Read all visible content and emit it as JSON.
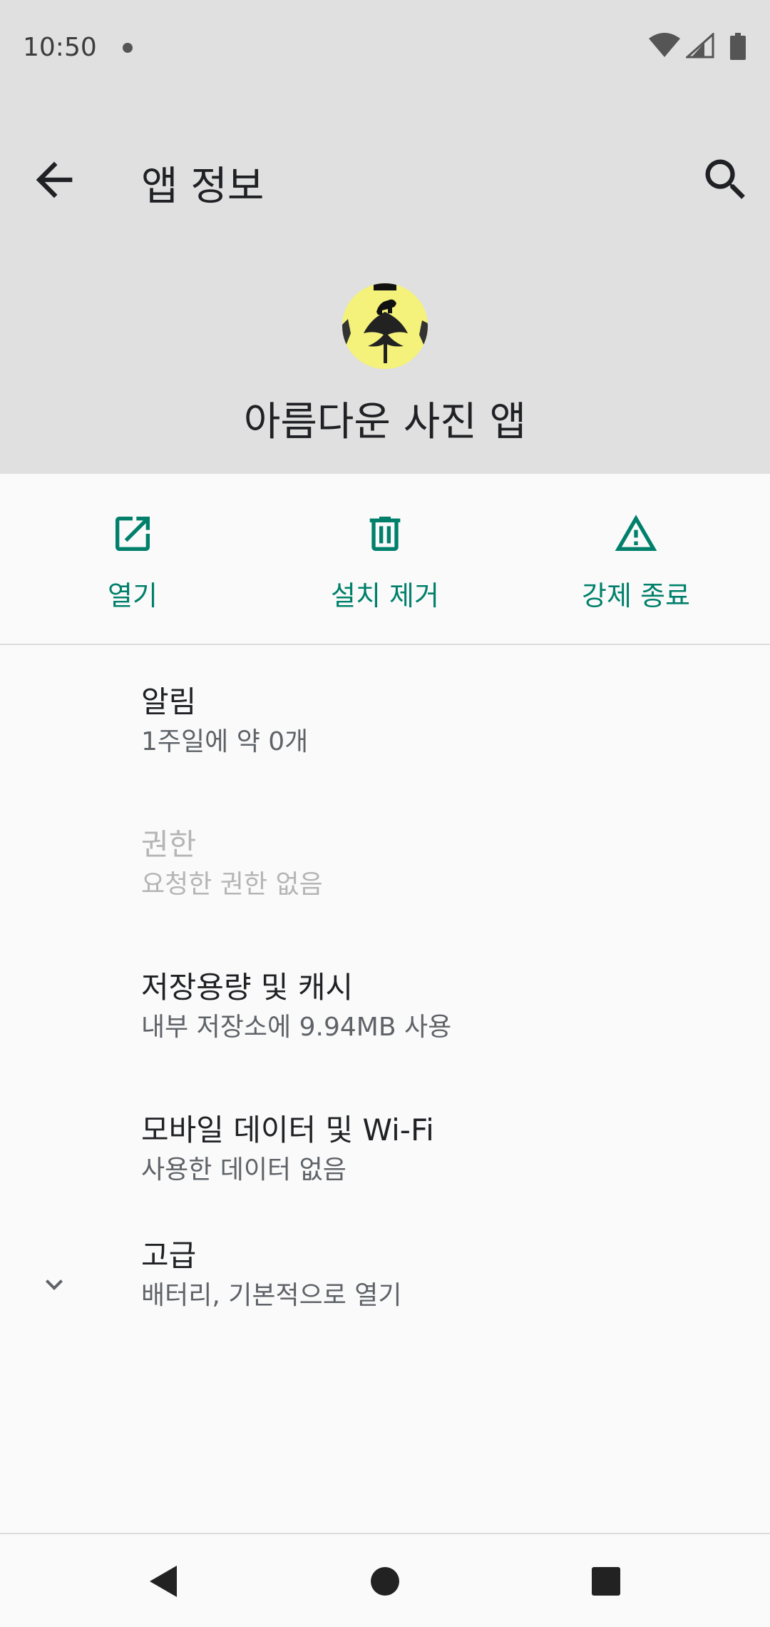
{
  "status_bar": {
    "time": "10:50",
    "icons": [
      "notification-dot",
      "wifi-icon",
      "cell-signal-icon",
      "battery-icon"
    ]
  },
  "app_bar": {
    "title": "앱 정보",
    "back_icon": "arrow-back-icon",
    "search_icon": "search-icon"
  },
  "app": {
    "name": "아름다운 사진 앱",
    "icon": "app-icon-monkey-tree"
  },
  "actions": [
    {
      "label": "열기",
      "icon": "open-external-icon"
    },
    {
      "label": "설치 제거",
      "icon": "trash-icon"
    },
    {
      "label": "강제 종료",
      "icon": "warning-icon"
    }
  ],
  "settings": [
    {
      "title": "알림",
      "summary": "1주일에 약 0개",
      "enabled": true
    },
    {
      "title": "권한",
      "summary": "요청한 권한 없음",
      "enabled": false
    },
    {
      "title": "저장용량 및 캐시",
      "summary": "내부 저장소에 9.94MB 사용",
      "enabled": true
    },
    {
      "title": "모바일 데이터 및 Wi-Fi",
      "summary": "사용한 데이터 없음",
      "enabled": true
    },
    {
      "title": "고급",
      "summary": "배터리, 기본적으로 열기",
      "enabled": true,
      "icon": "chevron-down-icon"
    }
  ],
  "nav_bar": {
    "buttons": [
      "back-triangle-icon",
      "home-circle-icon",
      "recents-square-icon"
    ]
  },
  "colors": {
    "accent": "#00806b",
    "header_bg": "#e0e0e0",
    "page_bg": "#fafafa",
    "disabled_text": "#b5b5b5"
  }
}
